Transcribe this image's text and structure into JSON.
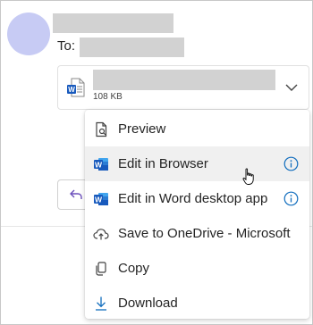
{
  "message": {
    "to_label": "To:"
  },
  "attachment": {
    "size": "108 KB",
    "file_icon": "word-file-icon"
  },
  "menu": {
    "items": [
      {
        "label": "Preview",
        "icon": "preview-icon"
      },
      {
        "label": "Edit in Browser",
        "icon": "word-icon",
        "info": true
      },
      {
        "label": "Edit in Word desktop app",
        "icon": "word-icon",
        "info": true
      },
      {
        "label": "Save to OneDrive - Microsoft",
        "icon": "cloud-upload-icon"
      },
      {
        "label": "Copy",
        "icon": "copy-icon"
      },
      {
        "label": "Download",
        "icon": "download-icon"
      }
    ]
  },
  "colors": {
    "word_blue": "#185abd",
    "info_blue": "#0f6cbd",
    "avatar": "#c7cbf4",
    "reply_purple": "#6b4fbb",
    "hover_bg": "#f0f0f0"
  }
}
